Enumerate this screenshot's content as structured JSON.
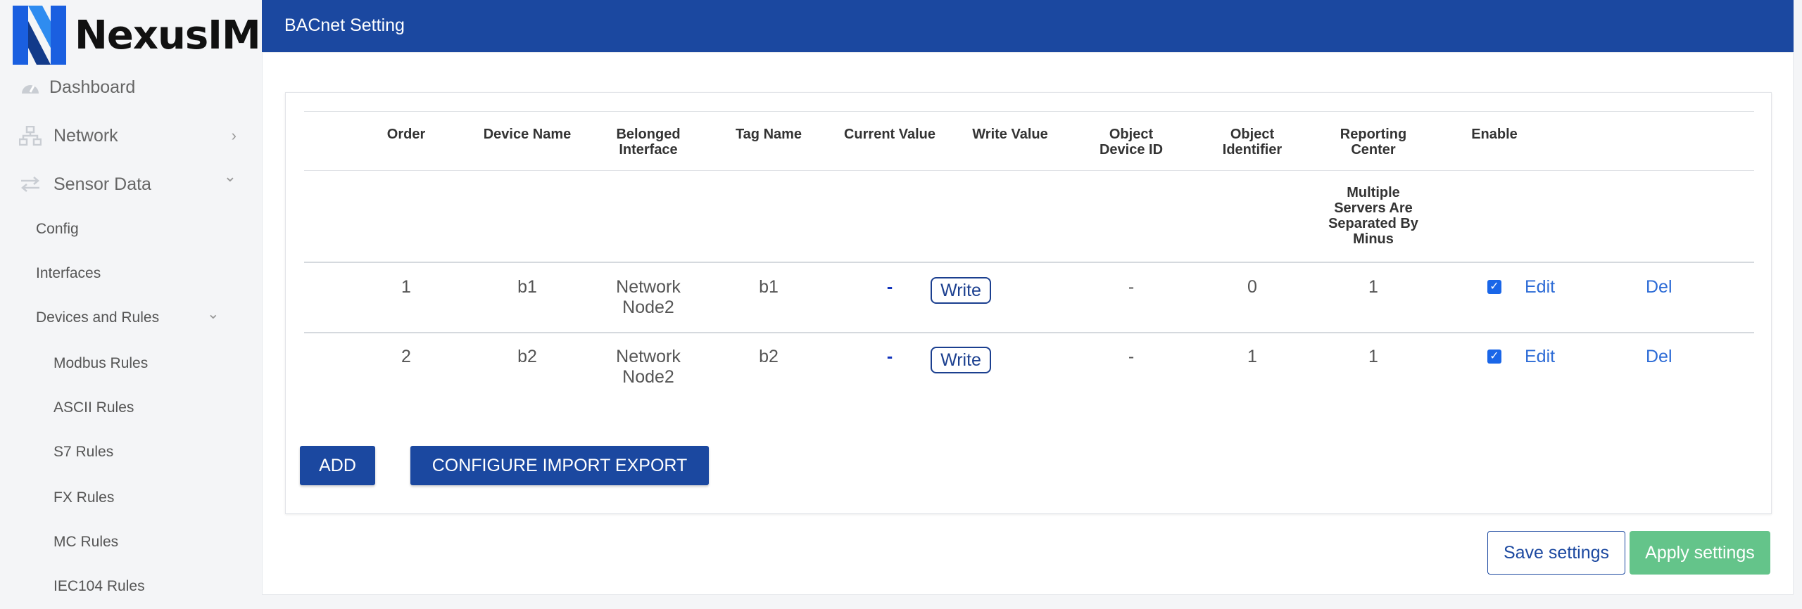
{
  "brand": {
    "name": "NexusIM"
  },
  "colors": {
    "header": "#1b48a0",
    "primary": "#1b48a0",
    "apply": "#64c48a",
    "link": "#2c6bd6",
    "checkbox": "#1a66e8"
  },
  "sidebar": {
    "dashboard": {
      "label": "Dashboard",
      "icon": "speedometer-icon"
    },
    "network": {
      "label": "Network",
      "icon": "network-icon",
      "chevron": "›"
    },
    "sensor_data": {
      "label": "Sensor Data",
      "icon": "swap-arrows-icon",
      "chevron": "⌄"
    },
    "sub": {
      "config": "Config",
      "interfaces": "Interfaces",
      "devices_and_rules": "Devices and Rules",
      "devices_chevron": "⌄",
      "rules": [
        "Modbus Rules",
        "ASCII Rules",
        "S7 Rules",
        "FX Rules",
        "MC Rules",
        "IEC104 Rules"
      ]
    }
  },
  "header": {
    "title": "BACnet Setting"
  },
  "table": {
    "headers": {
      "order": "Order",
      "device_name": "Device Name",
      "belonged_interface": [
        "Belonged",
        "Interface"
      ],
      "tag_name": "Tag Name",
      "current_value": "Current Value",
      "write_value": "Write Value",
      "object_device_id": [
        "Object",
        "Device ID"
      ],
      "object_identifier": [
        "Object",
        "Identifier"
      ],
      "reporting_center": [
        "Reporting",
        "Center"
      ],
      "enable": "Enable"
    },
    "reporting_note": [
      "Multiple",
      "Servers Are",
      "Separated By",
      "Minus"
    ],
    "rows": [
      {
        "order": "1",
        "device_name": "b1",
        "interface": [
          "Network",
          "Node2"
        ],
        "tag_name": "b1",
        "current_value": "-",
        "write_label": "Write",
        "object_device_id": "-",
        "object_identifier": "0",
        "reporting_center": "1",
        "enabled": true,
        "edit": "Edit",
        "del": "Del"
      },
      {
        "order": "2",
        "device_name": "b2",
        "interface": [
          "Network",
          "Node2"
        ],
        "tag_name": "b2",
        "current_value": "-",
        "write_label": "Write",
        "object_device_id": "-",
        "object_identifier": "1",
        "reporting_center": "1",
        "enabled": true,
        "edit": "Edit",
        "del": "Del"
      }
    ]
  },
  "actions": {
    "add": "ADD",
    "configure": "CONFIGURE IMPORT EXPORT"
  },
  "footer": {
    "save": "Save settings",
    "apply": "Apply settings"
  },
  "checkmark": "✓"
}
